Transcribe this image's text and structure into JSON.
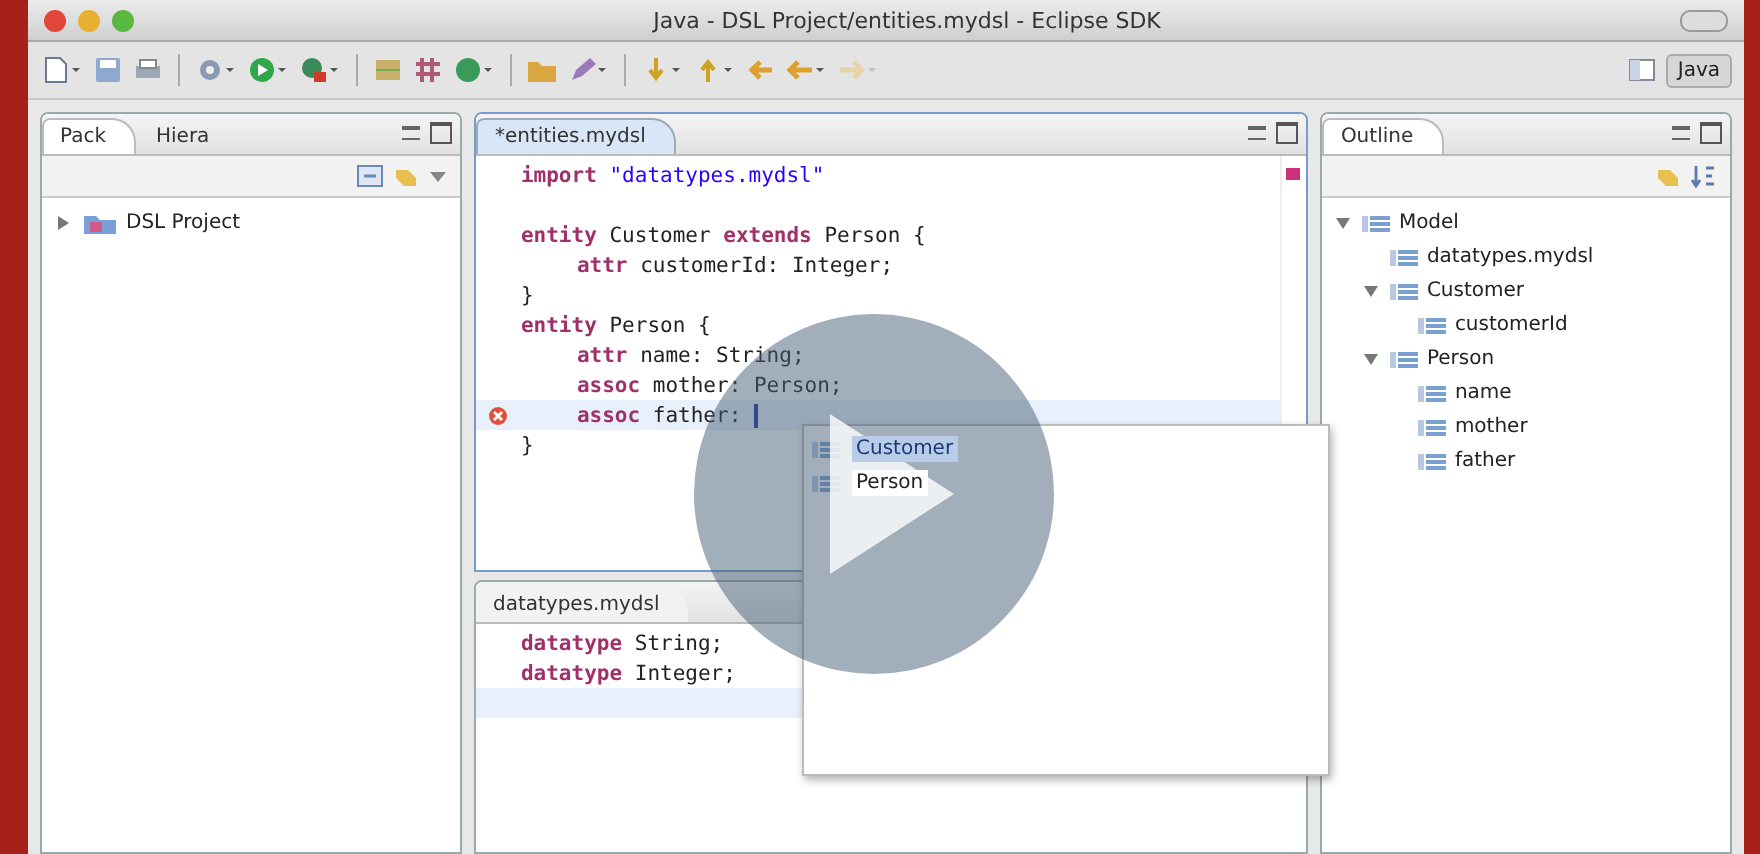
{
  "window": {
    "title": "Java - DSL Project/entities.mydsl - Eclipse SDK"
  },
  "perspective": {
    "label": "Java",
    "selected": true
  },
  "package_explorer": {
    "tabs": [
      {
        "label": "Pack",
        "selected": true
      },
      {
        "label": "Hiera",
        "selected": false
      }
    ],
    "items": [
      {
        "label": "DSL Project",
        "expanded": false
      }
    ]
  },
  "editor": {
    "tab": {
      "label": "*entities.mydsl",
      "selected": true
    },
    "lines": [
      {
        "current": false,
        "error": false,
        "indented": false,
        "tokens": [
          {
            "kind": "keyword",
            "text": "import"
          },
          {
            "kind": "string",
            "text": " \"datatypes.mydsl\""
          }
        ]
      },
      {
        "current": false,
        "error": false
      },
      {
        "current": false,
        "error": false,
        "indented": false,
        "tokens": [
          {
            "kind": "keyword",
            "text": "entity"
          },
          {
            "kind": "plain",
            "text": " Customer "
          },
          {
            "kind": "keyword",
            "text": "extends"
          },
          {
            "kind": "plain",
            "text": " Person {"
          }
        ]
      },
      {
        "current": false,
        "error": false,
        "indented": true,
        "tokens": [
          {
            "kind": "keyword",
            "text": "attr"
          },
          {
            "kind": "plain",
            "text": " customerId: Integer;"
          }
        ]
      },
      {
        "current": false,
        "error": false,
        "indented": false,
        "tokens": [
          {
            "kind": "plain",
            "text": "}"
          }
        ]
      },
      {
        "current": false,
        "error": false,
        "indented": false,
        "tokens": [
          {
            "kind": "keyword",
            "text": "entity"
          },
          {
            "kind": "plain",
            "text": " Person {"
          }
        ]
      },
      {
        "current": false,
        "error": false,
        "indented": true,
        "tokens": [
          {
            "kind": "keyword",
            "text": "attr"
          },
          {
            "kind": "plain",
            "text": " name: String;"
          }
        ]
      },
      {
        "current": false,
        "error": false,
        "indented": true,
        "tokens": [
          {
            "kind": "keyword",
            "text": "assoc"
          },
          {
            "kind": "plain",
            "text": " mother: Person;"
          }
        ]
      },
      {
        "current": true,
        "error": true,
        "indented": true,
        "tokens": [
          {
            "kind": "keyword",
            "text": "assoc"
          },
          {
            "kind": "plain",
            "text": " father:"
          }
        ]
      },
      {
        "current": false,
        "error": false,
        "indented": false,
        "tokens": [
          {
            "kind": "plain",
            "text": "}"
          }
        ]
      }
    ]
  },
  "completion": {
    "items": [
      {
        "label": "Customer",
        "selected": true
      },
      {
        "label": "Person",
        "selected": false
      }
    ]
  },
  "second_editor": {
    "tab": {
      "label": "datatypes.mydsl",
      "selected": false
    },
    "lines": [
      {
        "current": false,
        "indented": false,
        "tokens": [
          {
            "kind": "keyword",
            "text": "datatype"
          },
          {
            "kind": "plain",
            "text": " String;"
          }
        ]
      },
      {
        "current": false,
        "indented": false,
        "tokens": [
          {
            "kind": "keyword",
            "text": "datatype"
          },
          {
            "kind": "plain",
            "text": " Integer;"
          }
        ]
      },
      {
        "current": true
      }
    ]
  },
  "outline": {
    "tab": {
      "label": "Outline",
      "selected": true
    },
    "items": [
      {
        "label": "Model",
        "expanded": true,
        "children": [
          {
            "label": "datatypes.mydsl"
          },
          {
            "label": "Customer",
            "expanded": true,
            "children": [
              {
                "label": "customerId"
              }
            ]
          },
          {
            "label": "Person",
            "expanded": true,
            "children": [
              {
                "label": "name"
              },
              {
                "label": "mother"
              },
              {
                "label": "father"
              }
            ]
          }
        ]
      }
    ]
  },
  "video": {
    "play_overlay": true
  }
}
